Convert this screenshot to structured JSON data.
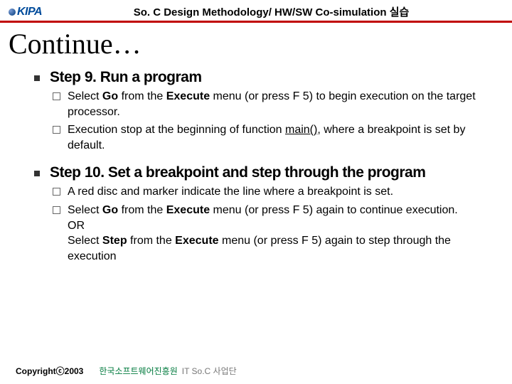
{
  "header": {
    "logo_text": "KIPA",
    "title": "So. C Design Methodology/ HW/SW Co-simulation 실습"
  },
  "slide_title": "Continue…",
  "steps": [
    {
      "title": "Step 9. Run a program",
      "items": [
        {
          "pre": "Select ",
          "b1": "Go",
          "mid1": " from the ",
          "b2": "Execute",
          "mid2": " menu (or press F 5) to begin execution on the target processor."
        },
        {
          "pre": "Execution stop at the beginning of function ",
          "u": "main()",
          "post": ", where a breakpoint is set by default."
        }
      ]
    },
    {
      "title": "Step 10. Set a breakpoint and step through the program",
      "items": [
        {
          "plain": "A red disc and marker indicate the line where a breakpoint is set."
        },
        {
          "pre": "Select ",
          "b1": "Go",
          "mid1": " from the ",
          "b2": "Execute",
          "mid2": " menu (or press F 5) again to continue execution.",
          "br": "OR",
          "pre2": "Select ",
          "b3": "Step",
          "mid3": " from the ",
          "b4": "Execute",
          "mid4": " menu (or press F 5) again to step through the execution"
        }
      ]
    }
  ],
  "footer": {
    "copyright": "Copyrightⓒ2003",
    "org": "한국소프트웨어진흥원",
    "sub": "IT So.C 사업단"
  }
}
